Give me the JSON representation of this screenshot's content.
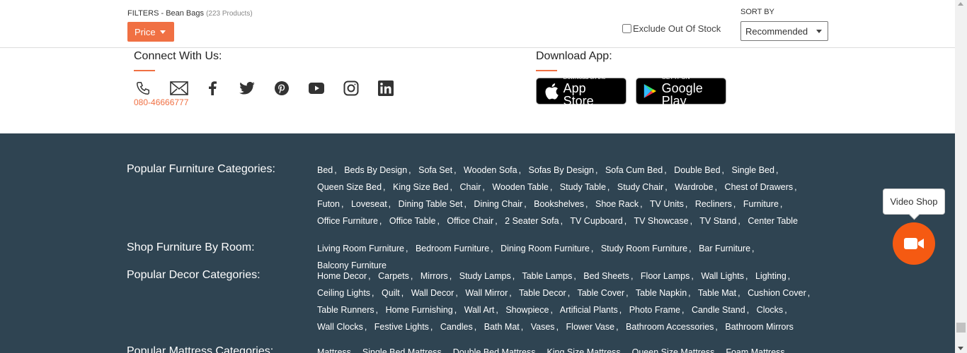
{
  "filters": {
    "prefix": "FILTERS - Bean Bags ",
    "count": "(223 Products)",
    "price_label": "Price",
    "exclude_label": "Exclude Out Of Stock",
    "sort_by_label": "SORT BY",
    "sort_value": "Recommended"
  },
  "connect": {
    "title": "Connect With Us:",
    "phone": "080-46666777",
    "icons": [
      "phone-icon",
      "mail-icon",
      "facebook-icon",
      "twitter-icon",
      "pinterest-icon",
      "youtube-icon",
      "instagram-icon",
      "linkedin-icon"
    ]
  },
  "download": {
    "title": "Download App:",
    "app_store_small": "Download on the",
    "app_store_big": "App Store",
    "google_small": "GET IT ON",
    "google_big": "Google Play"
  },
  "footer": {
    "sections": [
      {
        "title": "Popular Furniture Categories:",
        "links": [
          "Bed",
          "Beds By Design",
          "Sofa Set",
          "Wooden Sofa",
          "Sofas By Design",
          "Sofa Cum Bed",
          "Double Bed",
          "Single Bed",
          "Queen Size Bed",
          "King Size Bed",
          "Chair",
          "Wooden Table",
          "Study Table",
          "Study Chair",
          "Wardrobe",
          "Chest of Drawers",
          "Futon",
          "Loveseat",
          "Dining Table Set",
          "Dining Chair",
          "Bookshelves",
          "Shoe Rack",
          "TV Units",
          "Recliners",
          "Furniture",
          "Office Furniture",
          "Office Table",
          "Office Chair",
          "2 Seater Sofa",
          "TV Cupboard",
          "TV Showcase",
          "TV Stand",
          "Center Table"
        ]
      },
      {
        "title": "Shop Furniture By Room:",
        "links": [
          "Living Room Furniture",
          "Bedroom Furniture",
          "Dining Room Furniture",
          "Study Room Furniture",
          "Bar Furniture",
          "Balcony Furniture"
        ]
      },
      {
        "title": "Popular Decor Categories:",
        "links": [
          "Home Decor",
          "Carpets",
          "Mirrors",
          "Study Lamps",
          "Table Lamps",
          "Bed Sheets",
          "Floor Lamps",
          "Wall Lights",
          "Lighting",
          "Ceiling Lights",
          "Quilt",
          "Wall Decor",
          "Wall Mirror",
          "Table Decor",
          "Table Cover",
          "Table Napkin",
          "Table Mat",
          "Cushion Cover",
          "Table Runners",
          "Home Furnishing",
          "Wall Art",
          "Showpiece",
          "Artificial Plants",
          "Photo Frame",
          "Candle Stand",
          "Clocks",
          "Wall Clocks",
          "Festive Lights",
          "Candles",
          "Bath Mat",
          "Vases",
          "Flower Vase",
          "Bathroom Accessories",
          "Bathroom Mirrors"
        ]
      },
      {
        "title": "Popular Mattress Categories:",
        "links": [
          "Mattress",
          "Single Bed Mattress",
          "Double Bed Mattress",
          "King Size Mattress",
          "Queen Size Mattress",
          "Foam Mattress"
        ]
      }
    ]
  },
  "video_shop": {
    "label": "Video Shop"
  },
  "colors": {
    "accent": "#f07043",
    "footer_bg": "#2f4452",
    "video_button": "#f55a12"
  }
}
